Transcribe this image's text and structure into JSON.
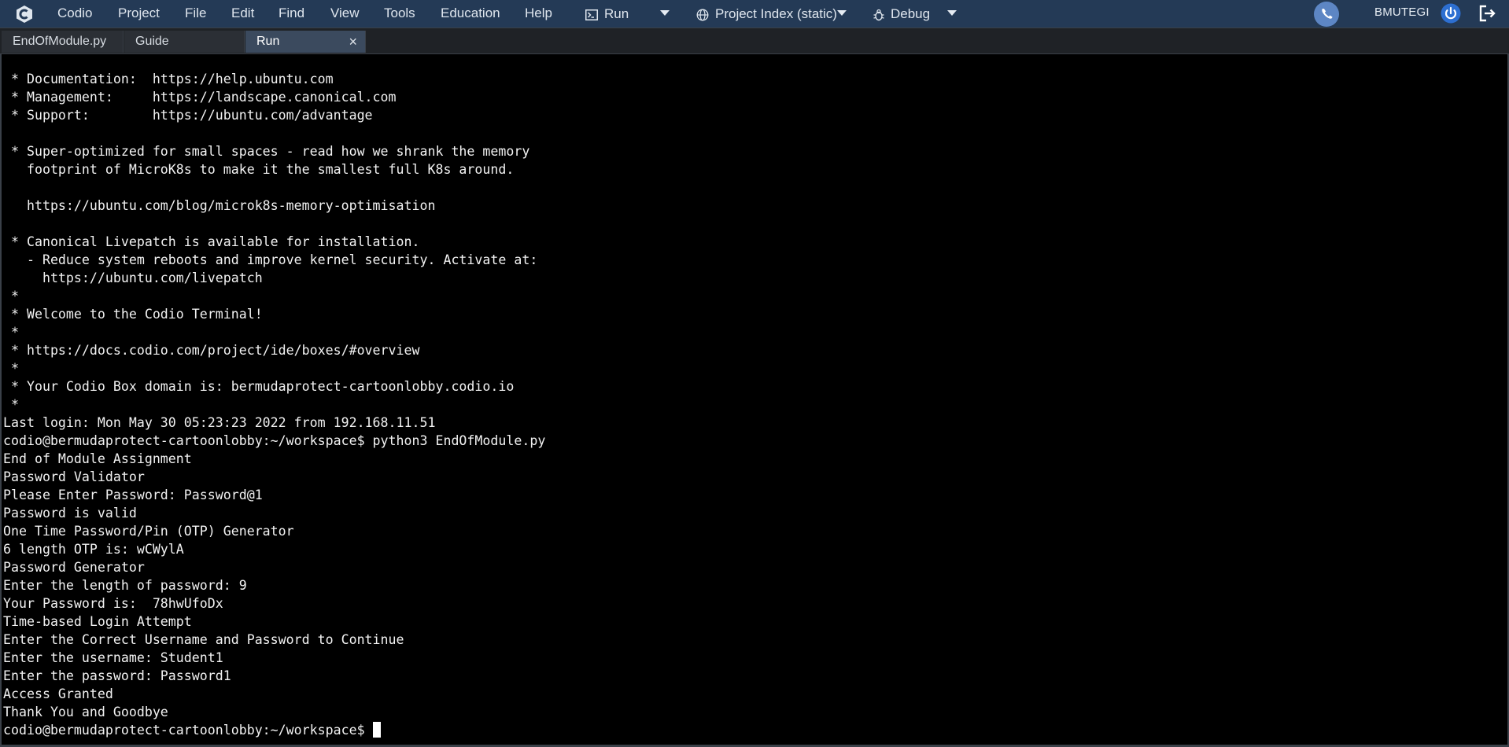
{
  "menubar": {
    "items": [
      "Codio",
      "Project",
      "File",
      "Edit",
      "Find",
      "View",
      "Tools",
      "Education",
      "Help"
    ],
    "run_label": "Run",
    "index_label": "Project Index (static)",
    "debug_label": "Debug",
    "username": "BMUTEGI",
    "icons": {
      "logo": "codio-logo-icon",
      "run": "terminal-run-icon",
      "index": "globe-icon",
      "debug": "bug-icon",
      "phone": "phone-icon",
      "power": "power-icon",
      "logout": "logout-icon"
    },
    "colors": {
      "bar": "#243a56",
      "phone_bg": "#5d86c4"
    }
  },
  "tabs": [
    {
      "label": "EndOfModule.py"
    },
    {
      "label": "Guide"
    },
    {
      "label": "Run",
      "active": true
    }
  ],
  "tab_close_glyph": "×",
  "terminal": {
    "lines": [
      " * Documentation:  https://help.ubuntu.com",
      " * Management:     https://landscape.canonical.com",
      " * Support:        https://ubuntu.com/advantage",
      "",
      " * Super-optimized for small spaces - read how we shrank the memory",
      "   footprint of MicroK8s to make it the smallest full K8s around.",
      "",
      "   https://ubuntu.com/blog/microk8s-memory-optimisation",
      "",
      " * Canonical Livepatch is available for installation.",
      "   - Reduce system reboots and improve kernel security. Activate at:",
      "     https://ubuntu.com/livepatch",
      " *",
      " * Welcome to the Codio Terminal!",
      " *",
      " * https://docs.codio.com/project/ide/boxes/#overview",
      " *",
      " * Your Codio Box domain is: bermudaprotect-cartoonlobby.codio.io",
      " *",
      "Last login: Mon May 30 05:23:23 2022 from 192.168.11.51",
      "codio@bermudaprotect-cartoonlobby:~/workspace$ python3 EndOfModule.py",
      "End of Module Assignment",
      "Password Validator",
      "Please Enter Password: Password@1",
      "Password is valid",
      "One Time Password/Pin (OTP) Generator",
      "6 length OTP is: wCWylA",
      "Password Generator",
      "Enter the length of password: 9",
      "Your Password is:  78hwUfoDx",
      "Time-based Login Attempt",
      "Enter the Correct Username and Password to Continue",
      "Enter the username: Student1",
      "Enter the password: Password1",
      "Access Granted",
      "Thank You and Goodbye"
    ],
    "prompt": "codio@bermudaprotect-cartoonlobby:~/workspace$"
  }
}
